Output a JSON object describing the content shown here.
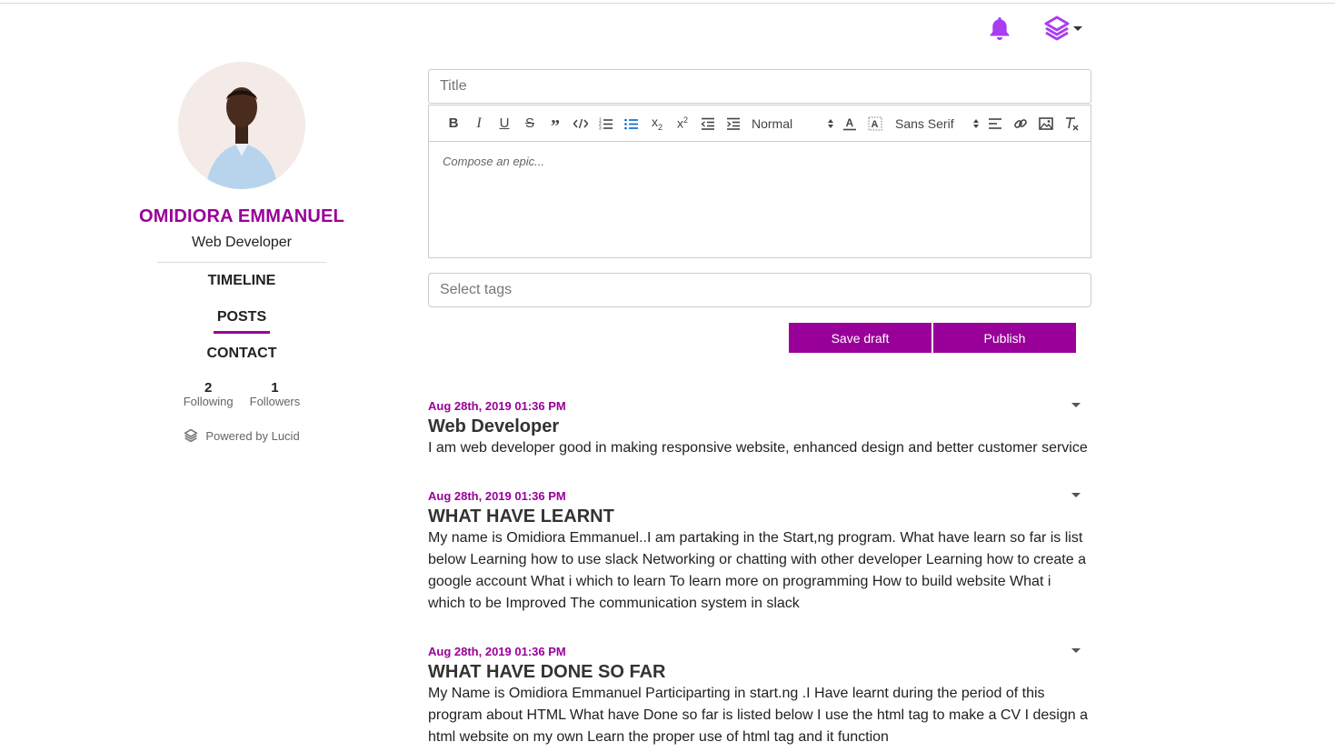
{
  "header": {
    "bell_icon": "bell-icon",
    "menu_icon": "lucid-logo-icon",
    "accent": "#a93ef0"
  },
  "profile": {
    "name": "OMIDIORA EMMANUEL",
    "role": "Web Developer",
    "nav": [
      {
        "label": "TIMELINE",
        "active": false
      },
      {
        "label": "POSTS",
        "active": true
      },
      {
        "label": "CONTACT",
        "active": false
      }
    ],
    "following_count": "2",
    "following_label": "Following",
    "followers_count": "1",
    "followers_label": "Followers",
    "powered_by": "Powered by Lucid"
  },
  "composer": {
    "title_placeholder": "Title",
    "body_placeholder": "Compose an epic...",
    "format_select": "Normal",
    "font_select": "Sans Serif",
    "tags_placeholder": "Select tags",
    "save_label": "Save draft",
    "publish_label": "Publish"
  },
  "posts": [
    {
      "date": "Aug 28th, 2019 01:36 PM",
      "title": "Web Developer",
      "body": "I am web developer good in making responsive website, enhanced design and better customer service"
    },
    {
      "date": "Aug 28th, 2019 01:36 PM",
      "title": "WHAT HAVE LEARNT",
      "body": "My name is Omidiora Emmanuel..I am partaking in the Start,ng program. What have learn so far is list below Learning how to use slack Networking or chatting with other developer Learning how to create a google account What i which to learn To learn more on programming How to build website What i which to be Improved The communication system in slack"
    },
    {
      "date": "Aug 28th, 2019 01:36 PM",
      "title": "WHAT HAVE DONE SO FAR",
      "body": "My Name is Omidiora Emmanuel Participarting in start.ng .I Have learnt during the period of this program about HTML What have Done so far is listed below I use the html tag to make a CV I design a html website on my own Learn the proper use of html tag and it function"
    }
  ],
  "colors": {
    "brand": "#990099",
    "border": "#cccccc"
  }
}
